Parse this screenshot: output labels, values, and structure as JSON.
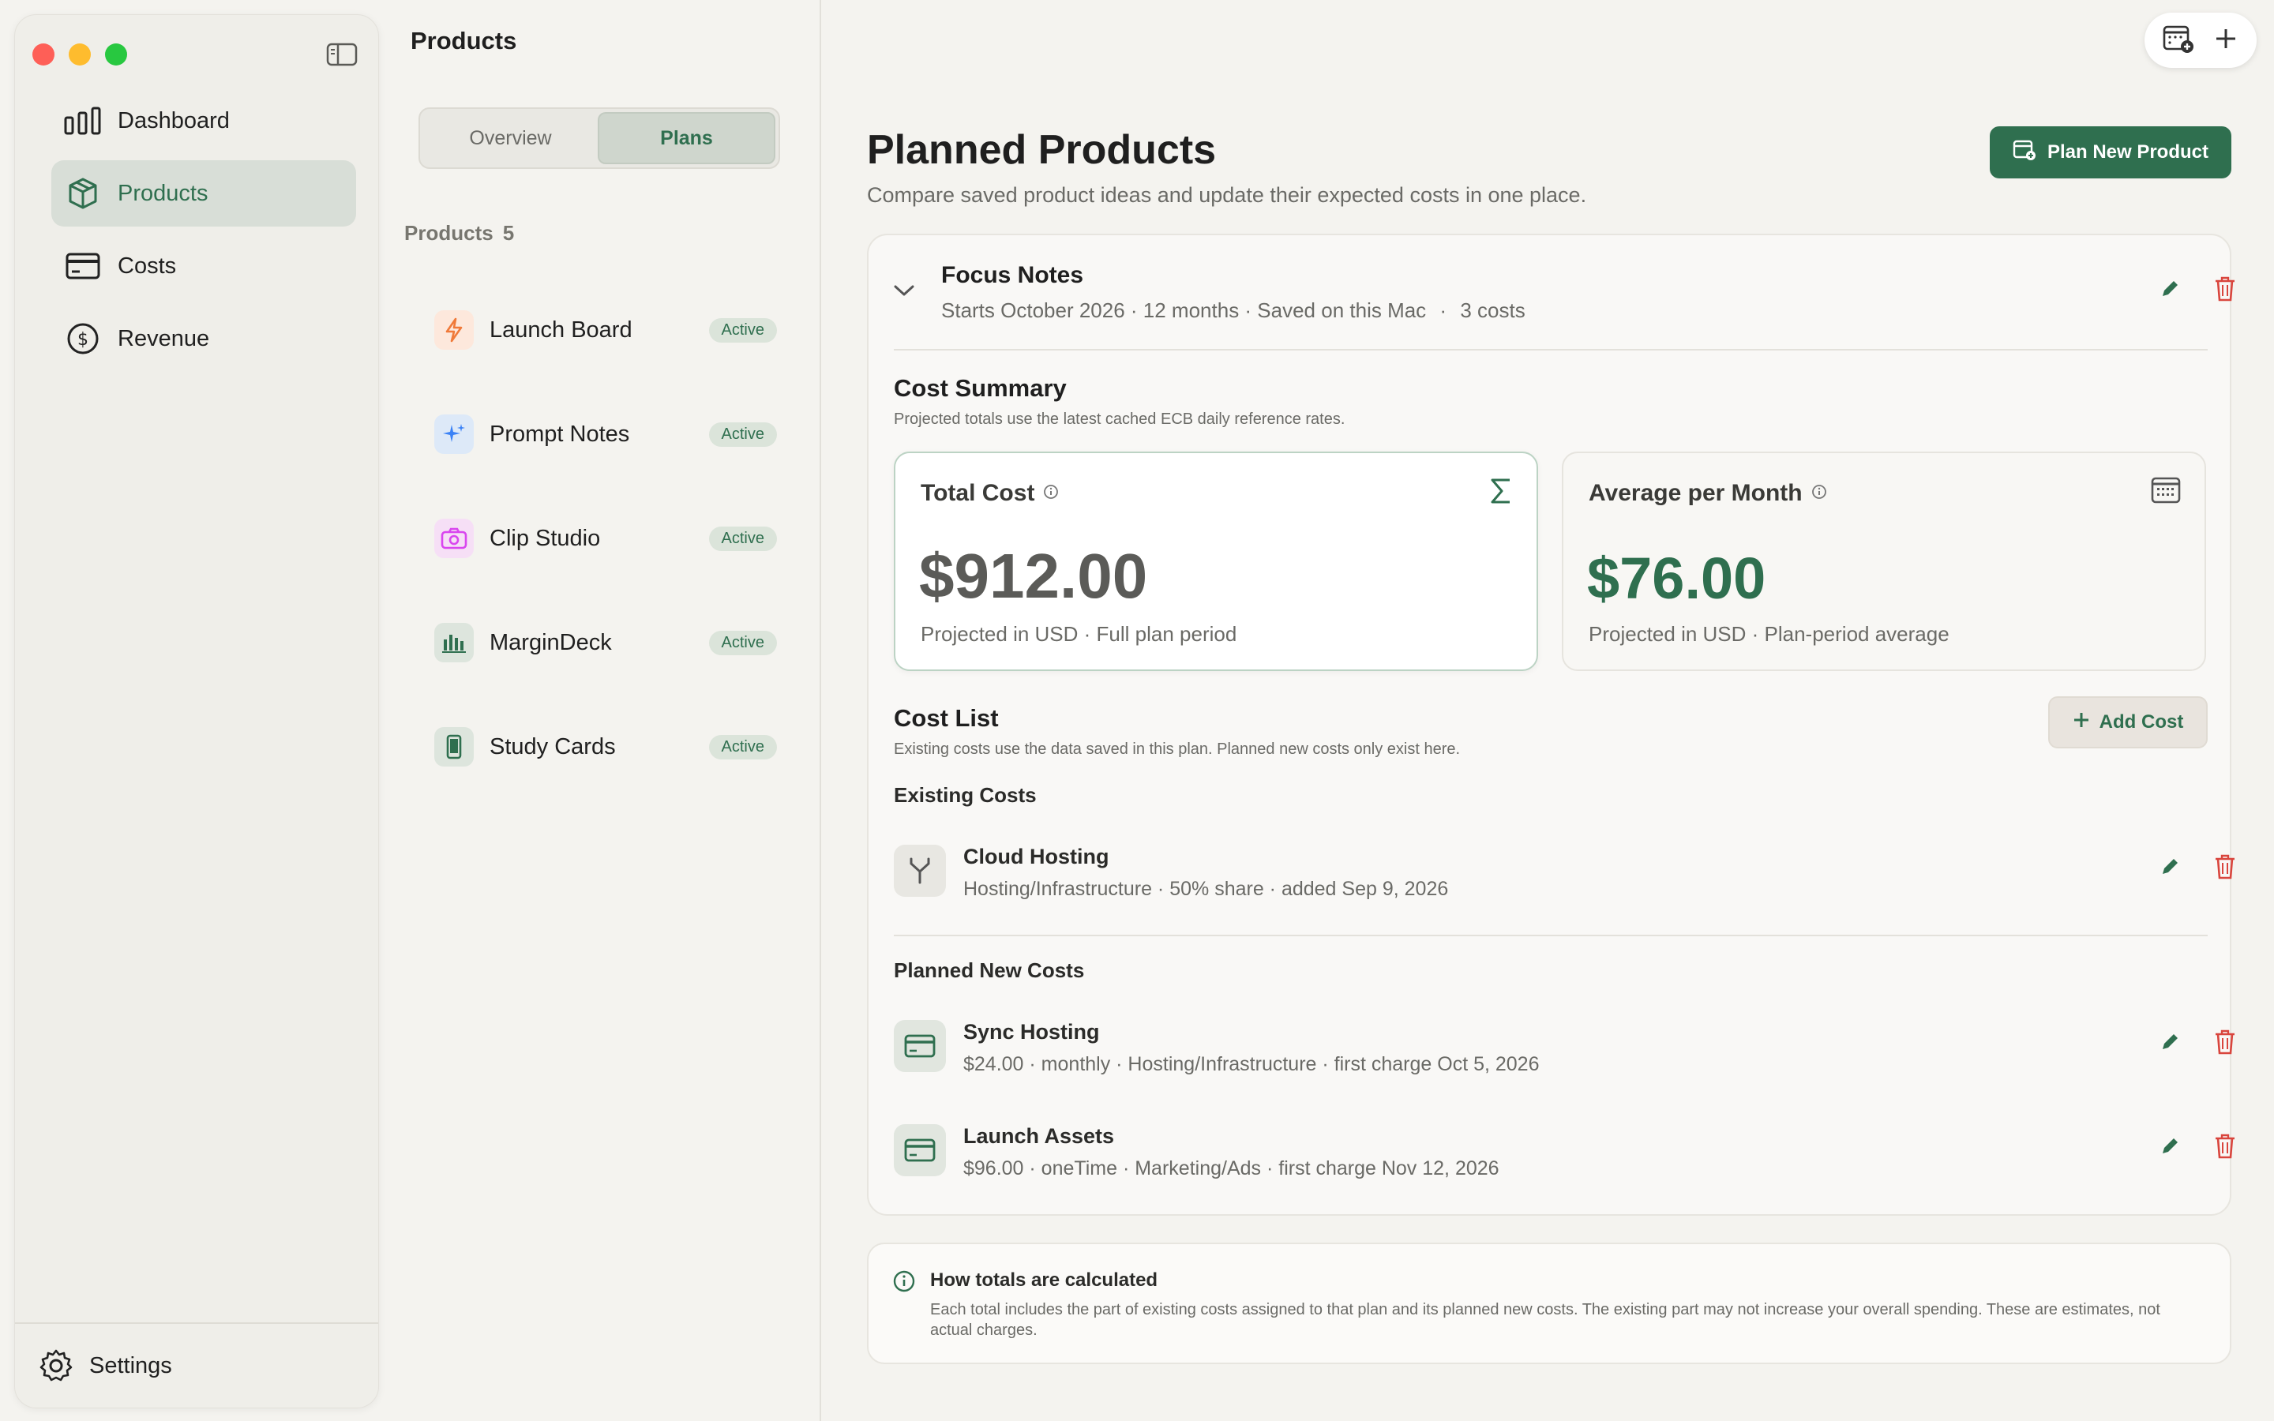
{
  "window": {
    "title": "Products"
  },
  "sidebar": {
    "items": [
      {
        "label": "Dashboard",
        "icon": "bar-chart-icon",
        "active": false
      },
      {
        "label": "Products",
        "icon": "box-icon",
        "active": true
      },
      {
        "label": "Costs",
        "icon": "credit-card-icon",
        "active": false
      },
      {
        "label": "Revenue",
        "icon": "dollar-circle-icon",
        "active": false
      }
    ],
    "settings_label": "Settings"
  },
  "middle": {
    "title": "Products",
    "tabs": [
      {
        "label": "Overview",
        "active": false
      },
      {
        "label": "Plans",
        "active": true
      }
    ],
    "products_label": "Products",
    "products_count": "5",
    "products": [
      {
        "name": "Launch Board",
        "status": "Active",
        "icon": "bolt-icon",
        "color": "#f07a3a"
      },
      {
        "name": "Prompt Notes",
        "status": "Active",
        "icon": "sparkle-icon",
        "color": "#3b82f6"
      },
      {
        "name": "Clip Studio",
        "status": "Active",
        "icon": "camera-icon",
        "color": "#d946ef"
      },
      {
        "name": "MarginDeck",
        "status": "Active",
        "icon": "chart-icon",
        "color": "#2f6f4f"
      },
      {
        "name": "Study Cards",
        "status": "Active",
        "icon": "phone-icon",
        "color": "#2f6f4f"
      }
    ]
  },
  "main": {
    "title": "Planned Products",
    "subtitle": "Compare saved product ideas and update their expected costs in one place.",
    "plan_button": "Plan New Product",
    "plan": {
      "name": "Focus Notes",
      "meta": "Starts October 2026 · 12 months · Saved on this Mac",
      "costs_count": "3 costs"
    },
    "cost_summary": {
      "title": "Cost Summary",
      "subtitle": "Projected totals use the latest cached ECB daily reference rates.",
      "total": {
        "label": "Total Cost",
        "value": "$912.00",
        "note": "Projected in USD · Full plan period"
      },
      "average": {
        "label": "Average per Month",
        "value": "$76.00",
        "note": "Projected in USD · Plan-period average"
      }
    },
    "cost_list": {
      "title": "Cost List",
      "subtitle": "Existing costs use the data saved in this plan. Planned new costs only exist here.",
      "add_button": "Add Cost",
      "existing_label": "Existing Costs",
      "existing": [
        {
          "name": "Cloud Hosting",
          "meta": "Hosting/Infrastructure · 50% share · added Sep 9, 2026"
        }
      ],
      "planned_label": "Planned New Costs",
      "planned": [
        {
          "name": "Sync Hosting",
          "meta": "$24.00 · monthly · Hosting/Infrastructure · first charge Oct 5, 2026"
        },
        {
          "name": "Launch Assets",
          "meta": "$96.00 · oneTime · Marketing/Ads · first charge Nov 12, 2026"
        }
      ]
    },
    "info": {
      "title": "How totals are calculated",
      "body": "Each total includes the part of existing costs assigned to that plan and its planned new costs. The existing part may not increase your overall spending. These are estimates, not actual charges."
    }
  },
  "colors": {
    "accent": "#2f6f4f",
    "danger": "#d9453d",
    "background": "#f4f3ef"
  }
}
